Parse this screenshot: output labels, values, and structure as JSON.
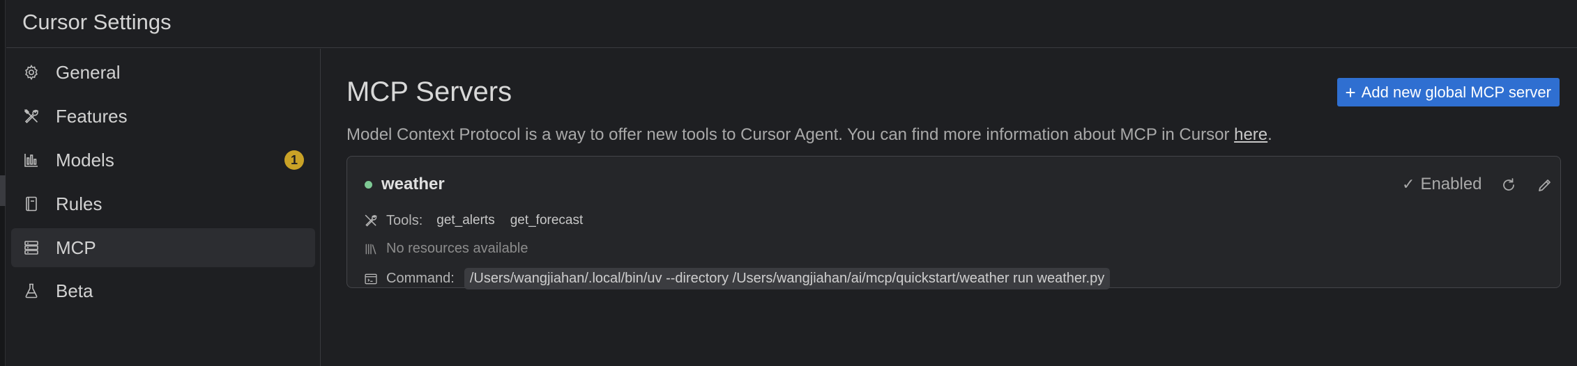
{
  "window": {
    "title": "Cursor Settings"
  },
  "sidebar": {
    "items": [
      {
        "id": "general",
        "label": "General",
        "icon": "gear-icon"
      },
      {
        "id": "features",
        "label": "Features",
        "icon": "tools-icon"
      },
      {
        "id": "models",
        "label": "Models",
        "icon": "bar-chart-icon",
        "badge": "1"
      },
      {
        "id": "rules",
        "label": "Rules",
        "icon": "book-icon"
      },
      {
        "id": "mcp",
        "label": "MCP",
        "icon": "server-icon",
        "active": true
      },
      {
        "id": "beta",
        "label": "Beta",
        "icon": "flask-icon"
      }
    ]
  },
  "main": {
    "heading": "MCP Servers",
    "add_button_label": "Add new global MCP server",
    "description_text": "Model Context Protocol is a way to offer new tools to Cursor Agent. You can find more information about MCP in Cursor ",
    "description_link": "here",
    "description_end": ".",
    "servers": [
      {
        "name": "weather",
        "status_text": "Enabled",
        "status_color": "#7ec994",
        "tools_label": "Tools:",
        "tools": [
          "get_alerts",
          "get_forecast"
        ],
        "resources_text": "No resources available",
        "command_label": "Command:",
        "command": "/Users/wangjiahan/.local/bin/uv --directory /Users/wangjiahan/ai/mcp/quickstart/weather run weather.py"
      }
    ]
  },
  "colors": {
    "accent": "#2f6fd1",
    "badge": "#c9a227",
    "background": "#1e1f22"
  }
}
